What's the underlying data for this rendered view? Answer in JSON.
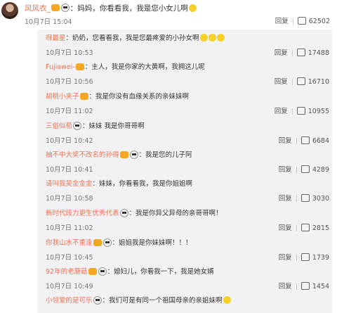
{
  "main": {
    "username": "风风衣_",
    "sep": "：",
    "text": "妈妈，你看看我，我是您小女儿啊",
    "time": "10月7日 15:04",
    "reply_label": "回复",
    "likes": "62502"
  },
  "replies": [
    {
      "name": "呀最星",
      "text": "：奶奶，您看看我，我是您最疼爱的小孙女啊",
      "time": "10月7日 10:53",
      "likes": "17488"
    },
    {
      "name": "Fujiawei-",
      "text": "：主人，我是你家的大黄啊，我拥这儿呢",
      "time": "10月7日 10:56",
      "likes": "16710"
    },
    {
      "name": "胡桃小夹子",
      "text": "：我是你没有血缘关系的亲妹妹啊",
      "time": "10月7日 11:02",
      "likes": "10955"
    },
    {
      "name": "三俗似荀",
      "text": "：妹妹 我是你哥哥啊",
      "time": "10月7日 10:42",
      "likes": "6684"
    },
    {
      "name": "抽不中大奖不改名的孙得",
      "text": "：我是您的儿子阿",
      "time": "10月7日 10:41",
      "likes": "4289"
    },
    {
      "name": "请叫我吴金金金",
      "text": "：妹妹，你看看我，我是你姐姐啊",
      "time": "10月7日 10:58",
      "likes": "3030"
    },
    {
      "name": "新时代段力更生优秀代表",
      "text": "：我是你异父异母的亲哥哥啊！",
      "time": "10月7日 11:02",
      "likes": "2815"
    },
    {
      "name": "你我山水不重逢",
      "text": "：姐姐我是你妹妹啊！！！",
      "time": "10月7日 10:45",
      "likes": "1739"
    },
    {
      "name": "92年的老蘑菇",
      "text": "：媳妇儿，你看我一下，我是她女婿",
      "time": "10月7日 10:49",
      "likes": "1454"
    },
    {
      "name": "小领爱的是可乐",
      "text": "：我们可是有同一个祖国母亲的亲姐妹啊",
      "time": "",
      "likes": ""
    }
  ],
  "reply_label": "回复"
}
